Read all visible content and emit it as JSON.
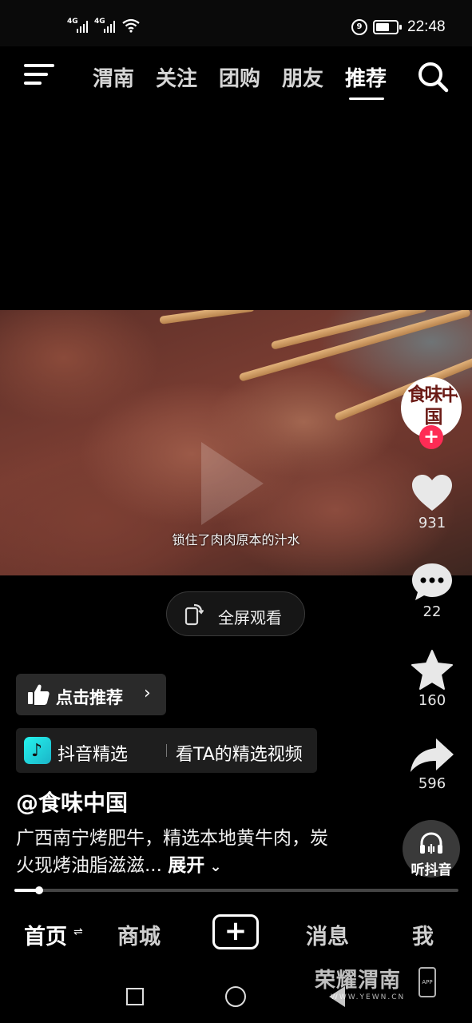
{
  "status_bar": {
    "signal_1": "4G",
    "signal_2": "4G",
    "alarm_glyph": "9",
    "battery_level": 0.7,
    "time": "22:48"
  },
  "top_nav": {
    "tabs": [
      {
        "label": "渭南"
      },
      {
        "label": "关注"
      },
      {
        "label": "团购"
      },
      {
        "label": "朋友"
      },
      {
        "label": "推荐",
        "active": true
      }
    ],
    "icons": [
      "menu-icon",
      "search-icon"
    ]
  },
  "video": {
    "subtitle": "锁住了肉肉原本的汁水",
    "fullscreen_label": "全屏观看"
  },
  "side_actions": {
    "avatar_text": "食味中国",
    "follow": "+",
    "like_count": "931",
    "comment_count": "22",
    "favorite_count": "160",
    "share_count": "596",
    "listen_label": "听抖音"
  },
  "info": {
    "recommend_label": "点击推荐",
    "selection_title": "抖音精选",
    "selection_sub": "看TA的精选视频",
    "author": "@食味中国",
    "description": "广西南宁烤肥牛，精选本地黄牛肉，炭火现烤油脂滋滋...",
    "expand_label": "展开"
  },
  "progress": {
    "played_fraction": 0.055
  },
  "bottom_tabs": {
    "home": "首页",
    "mall": "商城",
    "create": "+",
    "messages": "消息",
    "me": "我"
  },
  "watermark": {
    "brand": "荣耀渭南",
    "url": "WWW.YEWN.CN",
    "app": "APP"
  },
  "colors": {
    "accent_red": "#fe2c55",
    "douyin_cyan": "#25f4ee",
    "background": "#000000"
  }
}
